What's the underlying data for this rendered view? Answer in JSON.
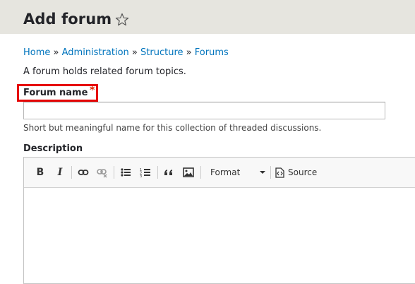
{
  "header": {
    "title": "Add forum"
  },
  "breadcrumb": {
    "items": [
      "Home",
      "Administration",
      "Structure",
      "Forums"
    ],
    "separator": "»"
  },
  "intro": "A forum holds related forum topics.",
  "forum_name": {
    "label": "Forum name",
    "required_marker": "*",
    "value": "",
    "help": "Short but meaningful name for this collection of threaded discussions."
  },
  "description": {
    "label": "Description",
    "toolbar": {
      "bold": "B",
      "italic": "I",
      "format_label": "Format",
      "source_label": "Source"
    }
  },
  "icons": [
    "star-icon",
    "bold-icon",
    "italic-icon",
    "link-icon",
    "unlink-icon",
    "bulleted-list-icon",
    "numbered-list-icon",
    "blockquote-icon",
    "image-icon",
    "chevron-down-icon",
    "source-icon"
  ],
  "colors": {
    "header_bg": "#e6e5df",
    "link": "#0074bd",
    "required": "#e32700",
    "highlight_box": "#e60000"
  }
}
